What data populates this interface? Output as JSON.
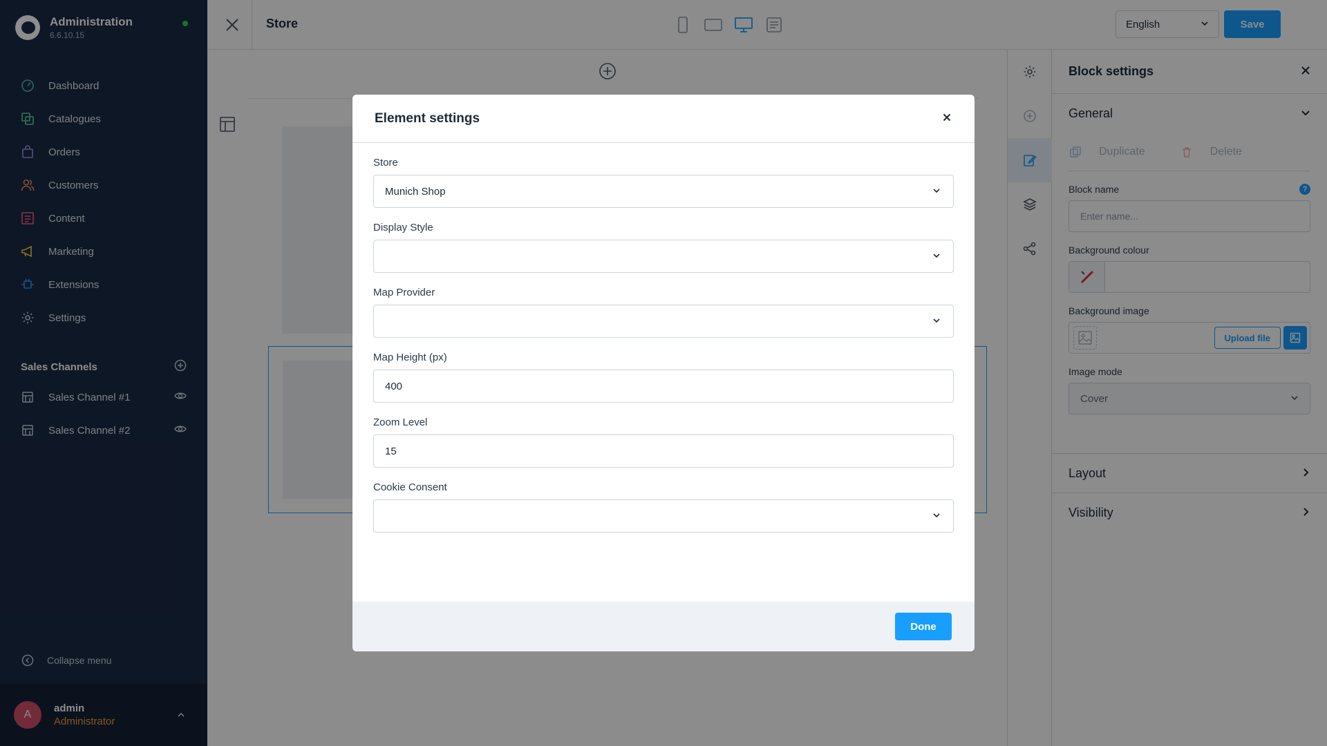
{
  "app": {
    "title": "Administration",
    "version": "6.6.10.15"
  },
  "nav": {
    "items": [
      {
        "label": "Dashboard",
        "icon": "gauge-icon",
        "color": "#4fc3b8"
      },
      {
        "label": "Catalogues",
        "icon": "catalogue-icon",
        "color": "#57d6a1"
      },
      {
        "label": "Orders",
        "icon": "bag-icon",
        "color": "#a38ff0"
      },
      {
        "label": "Customers",
        "icon": "users-icon",
        "color": "#f98c6b"
      },
      {
        "label": "Content",
        "icon": "content-icon",
        "color": "#ff5c8a"
      },
      {
        "label": "Marketing",
        "icon": "megaphone-icon",
        "color": "#ffd23b"
      },
      {
        "label": "Extensions",
        "icon": "plug-icon",
        "color": "#189eff"
      },
      {
        "label": "Settings",
        "icon": "gear-icon",
        "color": "#c7d1de"
      }
    ]
  },
  "sales_channels": {
    "title": "Sales Channels",
    "items": [
      {
        "label": "Sales Channel #1"
      },
      {
        "label": "Sales Channel #2"
      }
    ]
  },
  "sidebar_footer": {
    "collapse_label": "Collapse menu"
  },
  "user": {
    "initial": "A",
    "name": "admin",
    "role": "Administrator"
  },
  "topbar": {
    "page_title": "Store",
    "language": "English",
    "save_label": "Save"
  },
  "block_settings": {
    "title": "Block settings",
    "general_label": "General",
    "duplicate_label": "Duplicate",
    "delete_label": "Delete",
    "block_name_label": "Block name",
    "block_name_placeholder": "Enter name...",
    "bg_colour_label": "Background colour",
    "bg_image_label": "Background image",
    "upload_label": "Upload file",
    "image_mode_label": "Image mode",
    "image_mode_value": "Cover",
    "layout_label": "Layout",
    "visibility_label": "Visibility",
    "help_glyph": "?"
  },
  "modal": {
    "title": "Element settings",
    "store_label": "Store",
    "store_value": "Munich Shop",
    "display_style_label": "Display Style",
    "display_style_value": "",
    "map_provider_label": "Map Provider",
    "map_provider_value": "",
    "map_height_label": "Map Height (px)",
    "map_height_value": "400",
    "zoom_label": "Zoom Level",
    "zoom_value": "15",
    "cookie_label": "Cookie Consent",
    "cookie_value": "",
    "done_label": "Done"
  },
  "colors": {
    "sidebar": "#1b2a46",
    "accent": "#189eff",
    "role": "#f39c35",
    "avatar": "#d24d6c",
    "online": "#37d046"
  }
}
